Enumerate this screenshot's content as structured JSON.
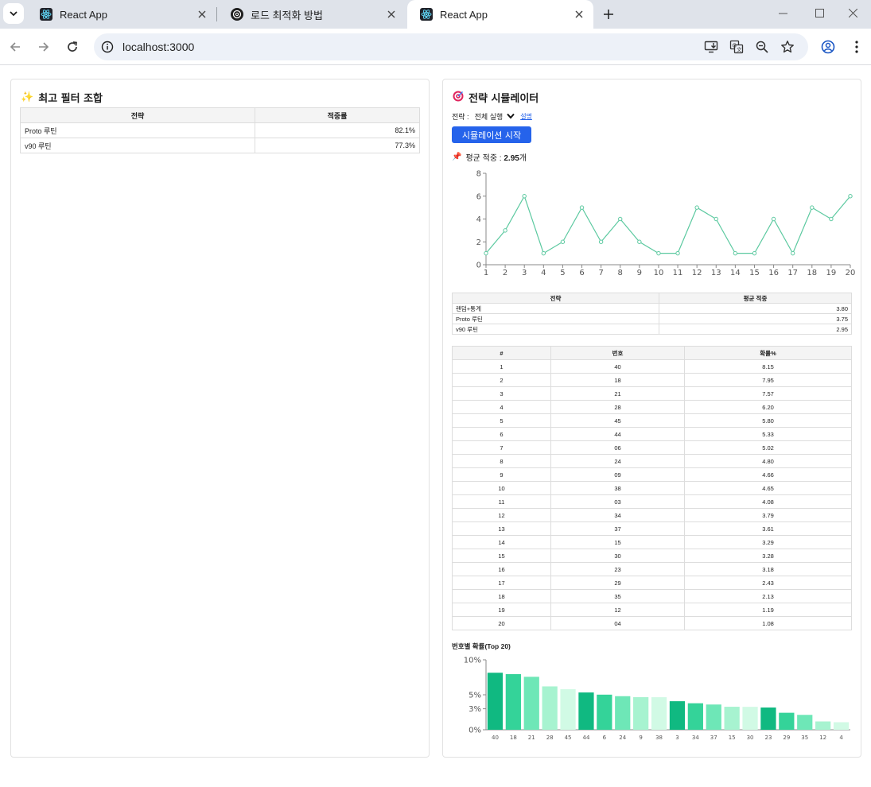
{
  "browser": {
    "tabs": [
      {
        "title": "React App",
        "favicon": "react-icon",
        "active": false
      },
      {
        "title": "로드 최적화 방법",
        "favicon": "chatgpt-icon",
        "active": false
      },
      {
        "title": "React App",
        "favicon": "react-icon",
        "active": true
      }
    ],
    "url": "localhost:3000"
  },
  "left_panel": {
    "title": "최고 필터 조합",
    "icon": "sparkles-icon",
    "headers": [
      "전략",
      "적중률"
    ],
    "rows": [
      {
        "strategy": "Proto 루틴",
        "rate": "82.1%"
      },
      {
        "strategy": "v90 루틴",
        "rate": "77.3%"
      }
    ]
  },
  "right_panel": {
    "title": "전략 시뮬레이터",
    "icon": "target-icon",
    "strategy_label": "전략 :",
    "strategy_value": "전체 실행",
    "help_link": "설명",
    "start_button": "시뮬레이션 시작",
    "avg_prefix": "평균 적중 : ",
    "avg_value": "2.95",
    "avg_suffix": "개",
    "avg_icon": "pushpin-icon",
    "strategy_table": {
      "headers": [
        "전략",
        "평균 적중"
      ],
      "rows": [
        {
          "name": "랜덤+통계",
          "avg": "3.80"
        },
        {
          "name": "Proto 루틴",
          "avg": "3.75"
        },
        {
          "name": "v90 루틴",
          "avg": "2.95"
        }
      ]
    },
    "prob_table": {
      "headers": [
        "#",
        "번호",
        "확률%"
      ],
      "rows": [
        {
          "rank": "1",
          "num": "40",
          "prob": "8.15"
        },
        {
          "rank": "2",
          "num": "18",
          "prob": "7.95"
        },
        {
          "rank": "3",
          "num": "21",
          "prob": "7.57"
        },
        {
          "rank": "4",
          "num": "28",
          "prob": "6.20"
        },
        {
          "rank": "5",
          "num": "45",
          "prob": "5.80"
        },
        {
          "rank": "6",
          "num": "44",
          "prob": "5.33"
        },
        {
          "rank": "7",
          "num": "06",
          "prob": "5.02"
        },
        {
          "rank": "8",
          "num": "24",
          "prob": "4.80"
        },
        {
          "rank": "9",
          "num": "09",
          "prob": "4.66"
        },
        {
          "rank": "10",
          "num": "38",
          "prob": "4.65"
        },
        {
          "rank": "11",
          "num": "03",
          "prob": "4.08"
        },
        {
          "rank": "12",
          "num": "34",
          "prob": "3.79"
        },
        {
          "rank": "13",
          "num": "37",
          "prob": "3.61"
        },
        {
          "rank": "14",
          "num": "15",
          "prob": "3.29"
        },
        {
          "rank": "15",
          "num": "30",
          "prob": "3.28"
        },
        {
          "rank": "16",
          "num": "23",
          "prob": "3.18"
        },
        {
          "rank": "17",
          "num": "29",
          "prob": "2.43"
        },
        {
          "rank": "18",
          "num": "35",
          "prob": "2.13"
        },
        {
          "rank": "19",
          "num": "12",
          "prob": "1.19"
        },
        {
          "rank": "20",
          "num": "04",
          "prob": "1.08"
        }
      ]
    },
    "bar_chart_title": "번호별 확률(Top 20)"
  },
  "colors": {
    "accent": "#2563eb",
    "line": "#5cc9a0",
    "bars": [
      "#10b981",
      "#34d399",
      "#6ee7b7",
      "#a7f3d0",
      "#d1fae5"
    ]
  },
  "chart_data": [
    {
      "type": "line",
      "title": "",
      "xlabel": "",
      "ylabel": "",
      "x": [
        1,
        2,
        3,
        4,
        5,
        6,
        7,
        8,
        9,
        10,
        11,
        12,
        13,
        14,
        15,
        16,
        17,
        18,
        19,
        20
      ],
      "series": [
        {
          "values": [
            1,
            3,
            6,
            1,
            2,
            5,
            2,
            4,
            2,
            1,
            1,
            5,
            4,
            1,
            1,
            4,
            1,
            5,
            4,
            6
          ]
        }
      ],
      "xlim": [
        1,
        20
      ],
      "ylim": [
        0,
        8
      ],
      "yticks": [
        0,
        2,
        4,
        6,
        8
      ],
      "grid": false
    },
    {
      "type": "bar",
      "title": "번호별 확률(Top 20)",
      "xlabel": "",
      "ylabel": "",
      "categories": [
        "40",
        "18",
        "21",
        "28",
        "45",
        "44",
        "6",
        "24",
        "9",
        "38",
        "3",
        "34",
        "37",
        "15",
        "30",
        "23",
        "29",
        "35",
        "12",
        "4"
      ],
      "values": [
        8.15,
        7.95,
        7.57,
        6.2,
        5.8,
        5.33,
        5.02,
        4.8,
        4.66,
        4.65,
        4.08,
        3.79,
        3.61,
        3.29,
        3.28,
        3.18,
        2.43,
        2.13,
        1.19,
        1.08
      ],
      "ylim": [
        0,
        10
      ],
      "yticks": [
        "0%",
        "3%",
        "5%",
        "10%"
      ],
      "grid": false
    }
  ]
}
